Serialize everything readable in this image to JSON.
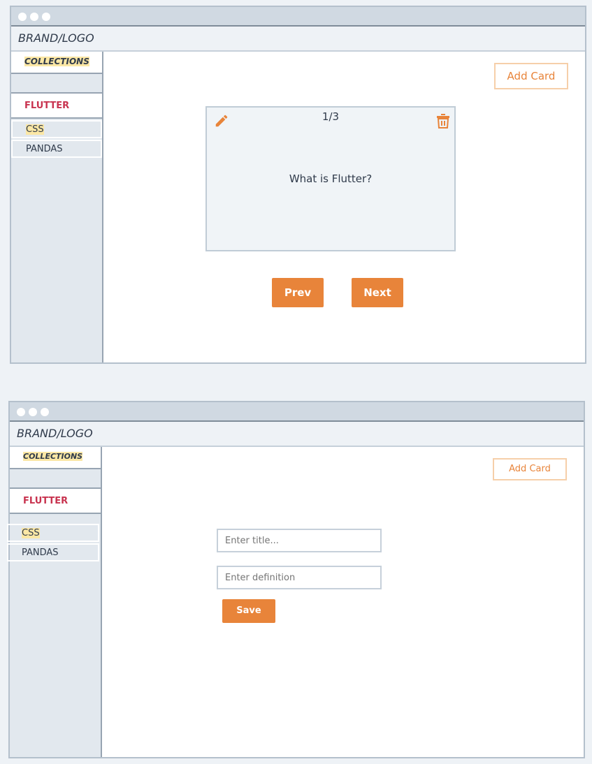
{
  "colors": {
    "accent": "#e8843a",
    "active_item": "#c8334f",
    "highlight": "#fbe7a5",
    "sidebar_bg": "#e2e8ee",
    "titlebar_bg": "#d0d9e2"
  },
  "viewer": {
    "brand": "BRAND/LOGO",
    "sidebar": {
      "header": "COLLECTIONS",
      "active": "FLUTTER",
      "items": [
        "CSS",
        "PANDAS"
      ]
    },
    "add_card_label": "Add Card",
    "card": {
      "counter": "1/3",
      "question": "What is Flutter?",
      "edit_icon": "pencil-icon",
      "delete_icon": "trash-icon"
    },
    "prev_label": "Prev",
    "next_label": "Next"
  },
  "editor": {
    "brand": "BRAND/LOGO",
    "sidebar": {
      "header": "COLLECTIONS",
      "active": "FLUTTER",
      "items": [
        "CSS",
        "PANDAS"
      ]
    },
    "add_card_label": "Add Card",
    "title_placeholder": "Enter title...",
    "definition_placeholder": "Enter definition",
    "save_label": "Save"
  }
}
